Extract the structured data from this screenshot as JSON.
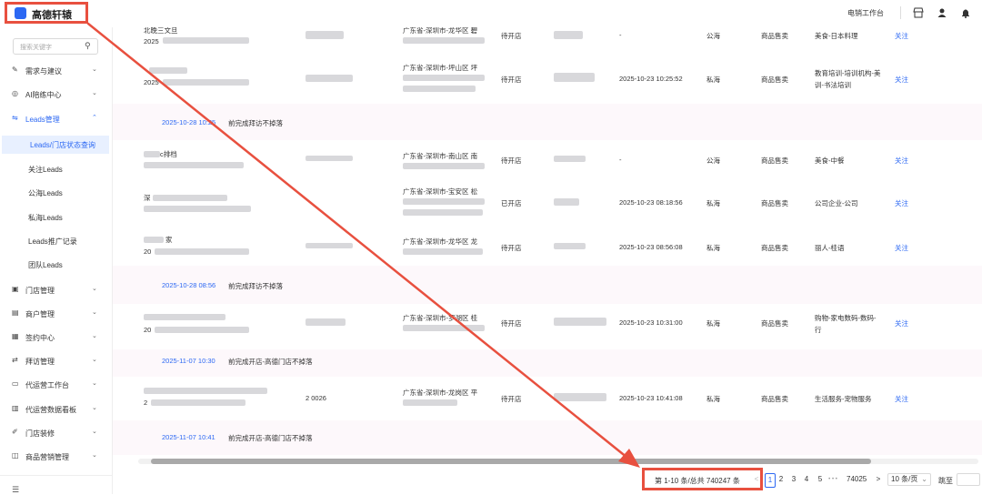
{
  "app": {
    "logo_text": "高德轩辕",
    "workbench": "电销工作台"
  },
  "topbar_icons": [
    "store-icon",
    "user-icon",
    "bell-icon"
  ],
  "sidebar": {
    "search_placeholder": "搜索关键字",
    "items": [
      {
        "label": "需求与建议",
        "icon": "edit-icon"
      },
      {
        "label": "AI陪练中心",
        "icon": "ai-icon"
      },
      {
        "label": "Leads管理",
        "icon": "leads-icon"
      },
      {
        "label": "Leads/门店状态查询"
      },
      {
        "label": "关注Leads"
      },
      {
        "label": "公海Leads"
      },
      {
        "label": "私海Leads"
      },
      {
        "label": "Leads推广记录"
      },
      {
        "label": "团队Leads"
      },
      {
        "label": "门店管理",
        "icon": "store-icon"
      },
      {
        "label": "商户管理",
        "icon": "merchant-icon"
      },
      {
        "label": "签约中心",
        "icon": "contract-icon"
      },
      {
        "label": "拜访管理",
        "icon": "visit-icon"
      },
      {
        "label": "代运营工作台",
        "icon": "desk-icon"
      },
      {
        "label": "代运营数据看板",
        "icon": "dashboard-icon"
      },
      {
        "label": "门店装修",
        "icon": "decor-icon"
      },
      {
        "label": "商品营销管理",
        "icon": "goods-icon"
      }
    ]
  },
  "rows": [
    {
      "name": "北晚三文旦",
      "sub": "2025",
      "region": "广东省-深圳市-龙华区 碧",
      "status": "待开店",
      "time": "-",
      "sea": "公海",
      "biz": "商品售卖",
      "cat": "美食-日本料理",
      "action": "关注"
    },
    {
      "name": "",
      "sub": "2025",
      "region": "广东省-深圳市-坪山区 坪",
      "status": "待开店",
      "time": "2025-10-23 10:25:52",
      "sea": "私海",
      "biz": "商品售卖",
      "cat": "教育培训-培训机构-美",
      "cat2": "训-书法培训",
      "action": "关注"
    },
    {
      "group": true,
      "time": "2025-10-28 10:25",
      "desc": "前完成拜访不掉落"
    },
    {
      "name": "c排档",
      "sub": "",
      "region": "广东省-深圳市-南山区 南",
      "status": "待开店",
      "time": "-",
      "sea": "公海",
      "biz": "商品售卖",
      "cat": "美食-中餐",
      "action": "关注"
    },
    {
      "name": "深",
      "sub": "",
      "region": "广东省-深圳市-宝安区 松",
      "status": "已开店",
      "time": "2025-10-23 08:18:56",
      "sea": "私海",
      "biz": "商品售卖",
      "cat": "公司企业-公司",
      "action": "关注"
    },
    {
      "name": "家",
      "sub": "20",
      "region": "广东省-深圳市-龙华区 龙",
      "status": "待开店",
      "time": "2025-10-23 08:56:08",
      "sea": "私海",
      "biz": "商品售卖",
      "cat": "丽人-桂语",
      "action": "关注"
    },
    {
      "group": true,
      "time": "2025-10-28 08:56",
      "desc": "前完成拜访不掉落"
    },
    {
      "name": "",
      "sub": "20",
      "region": "广东省-深圳市-罗湖区 桂",
      "status": "待开店",
      "time": "2025-10-23 10:31:00",
      "sea": "私海",
      "biz": "商品售卖",
      "cat": "购物-家电数码-数码-",
      "cat2": "行",
      "action": "关注"
    },
    {
      "group": true,
      "time": "2025-11-07 10:30",
      "desc": "前完成开店-高德门店不掉落"
    },
    {
      "name": "",
      "sub": "2",
      "region": "广东省-深圳市-龙岗区 平",
      "status": "待开店",
      "time": "2025-10-23 10:41:08",
      "sea": "私海",
      "biz": "商品售卖",
      "cat": "生活服务-宠物服务",
      "action": "关注",
      "code": "2   0026"
    },
    {
      "group": true,
      "time": "2025-11-07 10:41",
      "desc": "前完成开店-高德门店不掉落"
    }
  ],
  "pagination": {
    "total_text": "第 1-10 条/总共 740247 条",
    "prev": "<",
    "pages": [
      "1",
      "2",
      "3",
      "4",
      "5"
    ],
    "ellipsis": "• • •",
    "last": "74025",
    "next": ">",
    "page_size": "10 条/页",
    "jump_label": "跳至",
    "current": 1
  },
  "colors": {
    "accent": "#2c68f3",
    "annotation": "#e8503f"
  }
}
